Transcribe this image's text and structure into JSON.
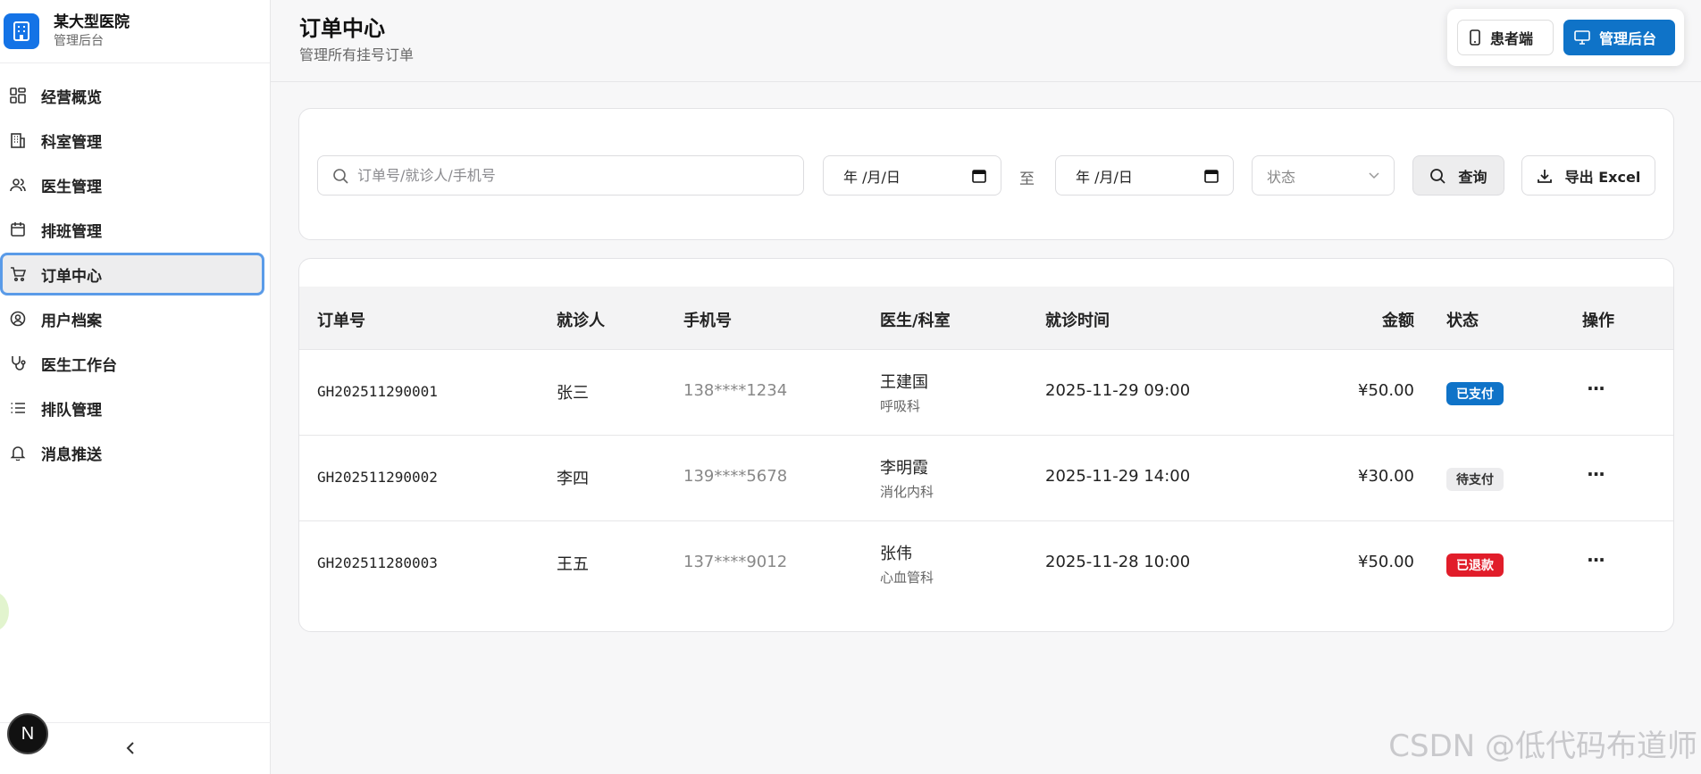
{
  "brand": {
    "title": "某大型医院",
    "subtitle": "管理后台",
    "logo_icon": "hospital-building-icon",
    "color": "#1473e6"
  },
  "sidebar": {
    "items": [
      {
        "label": "经营概览",
        "icon": "dashboard-grid-icon",
        "active": false
      },
      {
        "label": "科室管理",
        "icon": "building-icon",
        "active": false
      },
      {
        "label": "医生管理",
        "icon": "users-icon",
        "active": false
      },
      {
        "label": "排班管理",
        "icon": "calendar-icon",
        "active": false
      },
      {
        "label": "订单中心",
        "icon": "shopping-cart-icon",
        "active": true
      },
      {
        "label": "用户档案",
        "icon": "user-circle-icon",
        "active": false
      },
      {
        "label": "医生工作台",
        "icon": "stethoscope-icon",
        "active": false
      },
      {
        "label": "排队管理",
        "icon": "list-icon",
        "active": false
      },
      {
        "label": "消息推送",
        "icon": "bell-icon",
        "active": false
      }
    ],
    "collapse_icon": "chevron-left-icon"
  },
  "header": {
    "title": "订单中心",
    "subtitle": "管理所有挂号订单",
    "patient_label": "患者端",
    "admin_label": "管理后台",
    "accent": "#0f73c8"
  },
  "filters": {
    "search_placeholder": "订单号/就诊人/手机号",
    "date_from": "年 /月/日",
    "date_to": "年 /月/日",
    "separator": "至",
    "status_placeholder": "状态",
    "query_label": "查询",
    "export_label": "导出 Excel"
  },
  "table": {
    "headers": [
      "订单号",
      "就诊人",
      "手机号",
      "医生/科室",
      "就诊时间",
      "金额",
      "状态",
      "操作"
    ],
    "rows": [
      {
        "order_no": "GH202511290001",
        "patient": "张三",
        "phone": "138****1234",
        "doctor": "王建国",
        "dept": "呼吸科",
        "time": "2025-11-29 09:00",
        "amount": "¥50.00",
        "status": "已支付",
        "status_type": "paid",
        "op": "···"
      },
      {
        "order_no": "GH202511290002",
        "patient": "李四",
        "phone": "139****5678",
        "doctor": "李明霞",
        "dept": "消化内科",
        "time": "2025-11-29 14:00",
        "amount": "¥30.00",
        "status": "待支付",
        "status_type": "pending",
        "op": "···"
      },
      {
        "order_no": "GH202511280003",
        "patient": "王五",
        "phone": "137****9012",
        "doctor": "张伟",
        "dept": "心血管科",
        "time": "2025-11-28 10:00",
        "amount": "¥50.00",
        "status": "已退款",
        "status_type": "refund",
        "op": "···"
      }
    ]
  },
  "badge": {
    "letter": "N"
  },
  "watermark": "CSDN @低代码布道师"
}
